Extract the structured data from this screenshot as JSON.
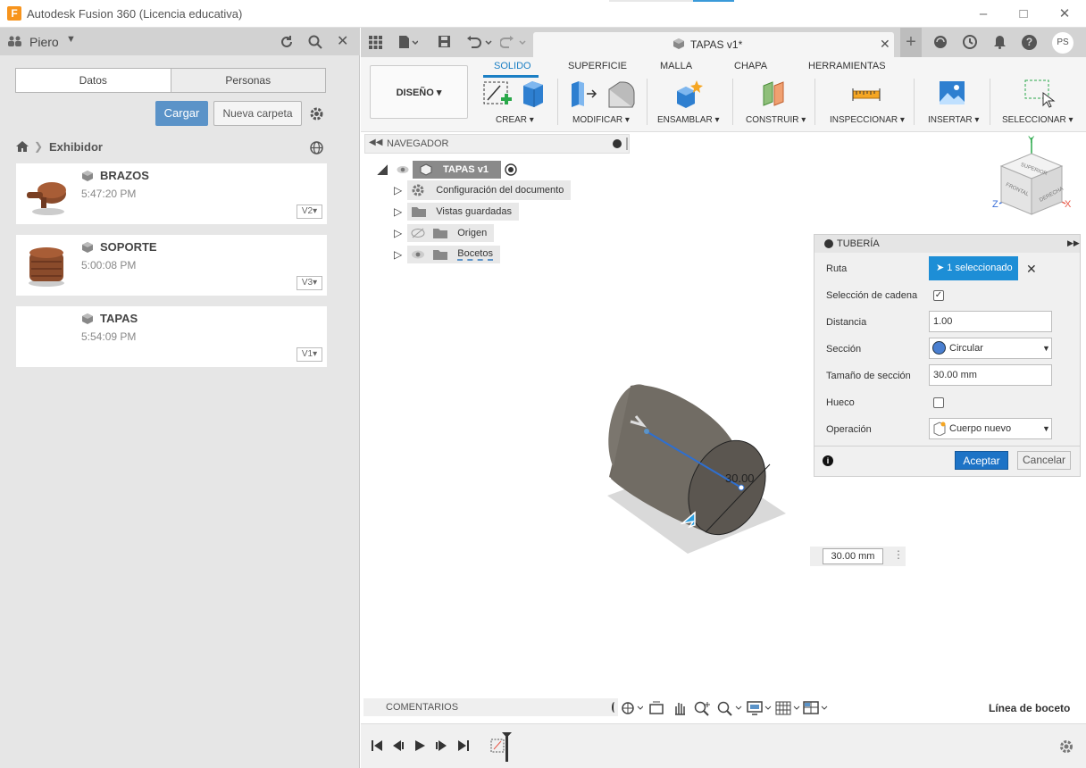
{
  "window": {
    "title": "Autodesk Fusion 360 (Licencia educativa)",
    "logo": "F"
  },
  "left_panel": {
    "user": "Piero",
    "tabs": [
      "Datos",
      "Personas"
    ],
    "upload_button": "Cargar",
    "new_folder_button": "Nueva carpeta",
    "breadcrumb": "Exhibidor",
    "files": [
      {
        "name": "BRAZOS",
        "time": "5:47:20 PM",
        "version": "V2"
      },
      {
        "name": "SOPORTE",
        "time": "5:00:08 PM",
        "version": "V3"
      },
      {
        "name": "TAPAS",
        "time": "5:54:09 PM",
        "version": "V1"
      }
    ]
  },
  "top": {
    "doc_tab": "TAPAS v1*",
    "user_initials": "PS"
  },
  "ribbon": {
    "workspace": "DISEÑO",
    "tabs": [
      "SOLIDO",
      "SUPERFICIE",
      "MALLA",
      "CHAPA",
      "HERRAMIENTAS"
    ],
    "groups": [
      "CREAR",
      "MODIFICAR",
      "ENSAMBLAR",
      "CONSTRUIR",
      "INSPECCIONAR",
      "INSERTAR",
      "SELECCIONAR"
    ]
  },
  "navigator": {
    "title": "NAVEGADOR",
    "root": "TAPAS v1",
    "items": [
      "Configuración del documento",
      "Vistas guardadas",
      "Origen",
      "Bocetos"
    ]
  },
  "viewcube": {
    "top": "SUPERIOR",
    "front": "FRONTAL",
    "right": "DERECHA",
    "axis_x": "X",
    "axis_y": "Y",
    "axis_z": "Z"
  },
  "tuberia": {
    "title": "TUBERÍA",
    "ruta_label": "Ruta",
    "ruta_value": "1 seleccionado",
    "cadena_label": "Selección de cadena",
    "distancia_label": "Distancia",
    "distancia_value": "1.00",
    "seccion_label": "Sección",
    "seccion_value": "Circular",
    "tamano_label": "Tamaño de sección",
    "tamano_value": "30.00 mm",
    "hueco_label": "Hueco",
    "operacion_label": "Operación",
    "operacion_value": "Cuerpo nuevo",
    "accept": "Aceptar",
    "cancel": "Cancelar"
  },
  "viewport": {
    "dimension": "30.00",
    "input_value": "30.00 mm"
  },
  "bottom": {
    "comments": "COMENTARIOS",
    "status": "Línea de boceto"
  }
}
